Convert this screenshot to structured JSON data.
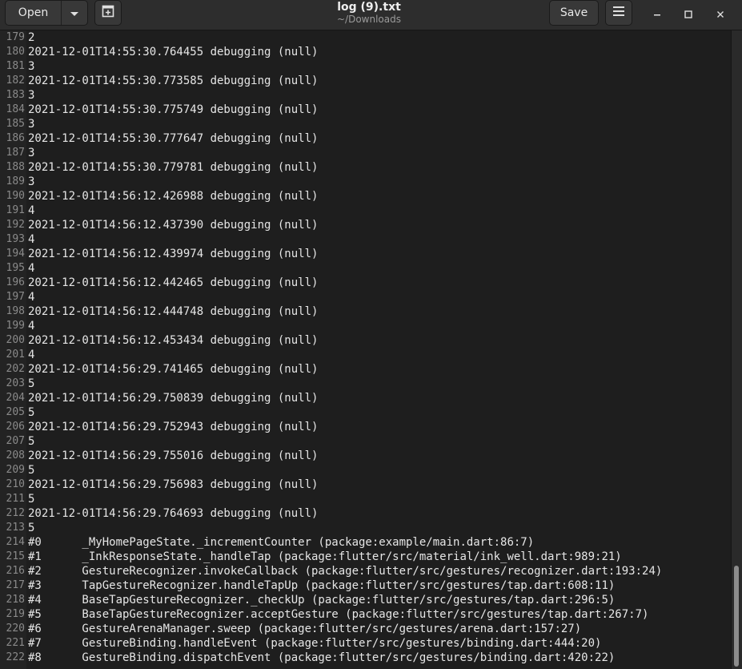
{
  "header": {
    "open_label": "Open",
    "title": "log (9).txt",
    "subtitle": "~/Downloads",
    "save_label": "Save"
  },
  "icons": {
    "open_dropdown": "chevron-down-icon",
    "new_tab": "new-tab-icon",
    "menu": "hamburger-menu-icon",
    "minimize": "minimize-icon",
    "maximize": "maximize-icon",
    "close": "close-icon"
  },
  "colors": {
    "headerbar": "#2d2d2d",
    "editor_bg": "#1e1e1e",
    "text": "#e6e6e6",
    "line_number": "#8a8a8a"
  },
  "editor": {
    "lines": [
      {
        "n": "179",
        "text": "2"
      },
      {
        "n": "180",
        "text": "2021-12-01T14:55:30.764455 debugging (null)"
      },
      {
        "n": "181",
        "text": "3"
      },
      {
        "n": "182",
        "text": "2021-12-01T14:55:30.773585 debugging (null)"
      },
      {
        "n": "183",
        "text": "3"
      },
      {
        "n": "184",
        "text": "2021-12-01T14:55:30.775749 debugging (null)"
      },
      {
        "n": "185",
        "text": "3"
      },
      {
        "n": "186",
        "text": "2021-12-01T14:55:30.777647 debugging (null)"
      },
      {
        "n": "187",
        "text": "3"
      },
      {
        "n": "188",
        "text": "2021-12-01T14:55:30.779781 debugging (null)"
      },
      {
        "n": "189",
        "text": "3"
      },
      {
        "n": "190",
        "text": "2021-12-01T14:56:12.426988 debugging (null)"
      },
      {
        "n": "191",
        "text": "4"
      },
      {
        "n": "192",
        "text": "2021-12-01T14:56:12.437390 debugging (null)"
      },
      {
        "n": "193",
        "text": "4"
      },
      {
        "n": "194",
        "text": "2021-12-01T14:56:12.439974 debugging (null)"
      },
      {
        "n": "195",
        "text": "4"
      },
      {
        "n": "196",
        "text": "2021-12-01T14:56:12.442465 debugging (null)"
      },
      {
        "n": "197",
        "text": "4"
      },
      {
        "n": "198",
        "text": "2021-12-01T14:56:12.444748 debugging (null)"
      },
      {
        "n": "199",
        "text": "4"
      },
      {
        "n": "200",
        "text": "2021-12-01T14:56:12.453434 debugging (null)"
      },
      {
        "n": "201",
        "text": "4"
      },
      {
        "n": "202",
        "text": "2021-12-01T14:56:29.741465 debugging (null)"
      },
      {
        "n": "203",
        "text": "5"
      },
      {
        "n": "204",
        "text": "2021-12-01T14:56:29.750839 debugging (null)"
      },
      {
        "n": "205",
        "text": "5"
      },
      {
        "n": "206",
        "text": "2021-12-01T14:56:29.752943 debugging (null)"
      },
      {
        "n": "207",
        "text": "5"
      },
      {
        "n": "208",
        "text": "2021-12-01T14:56:29.755016 debugging (null)"
      },
      {
        "n": "209",
        "text": "5"
      },
      {
        "n": "210",
        "text": "2021-12-01T14:56:29.756983 debugging (null)"
      },
      {
        "n": "211",
        "text": "5"
      },
      {
        "n": "212",
        "text": "2021-12-01T14:56:29.764693 debugging (null)"
      },
      {
        "n": "213",
        "text": "5"
      },
      {
        "n": "214",
        "text": "#0      _MyHomePageState._incrementCounter (package:example/main.dart:86:7)"
      },
      {
        "n": "215",
        "text": "#1      _InkResponseState._handleTap (package:flutter/src/material/ink_well.dart:989:21)"
      },
      {
        "n": "216",
        "text": "#2      GestureRecognizer.invokeCallback (package:flutter/src/gestures/recognizer.dart:193:24)"
      },
      {
        "n": "217",
        "text": "#3      TapGestureRecognizer.handleTapUp (package:flutter/src/gestures/tap.dart:608:11)"
      },
      {
        "n": "218",
        "text": "#4      BaseTapGestureRecognizer._checkUp (package:flutter/src/gestures/tap.dart:296:5)"
      },
      {
        "n": "219",
        "text": "#5      BaseTapGestureRecognizer.acceptGesture (package:flutter/src/gestures/tap.dart:267:7)"
      },
      {
        "n": "220",
        "text": "#6      GestureArenaManager.sweep (package:flutter/src/gestures/arena.dart:157:27)"
      },
      {
        "n": "221",
        "text": "#7      GestureBinding.handleEvent (package:flutter/src/gestures/binding.dart:444:20)"
      },
      {
        "n": "222",
        "text": "#8      GestureBinding.dispatchEvent (package:flutter/src/gestures/binding.dart:420:22)"
      }
    ]
  }
}
